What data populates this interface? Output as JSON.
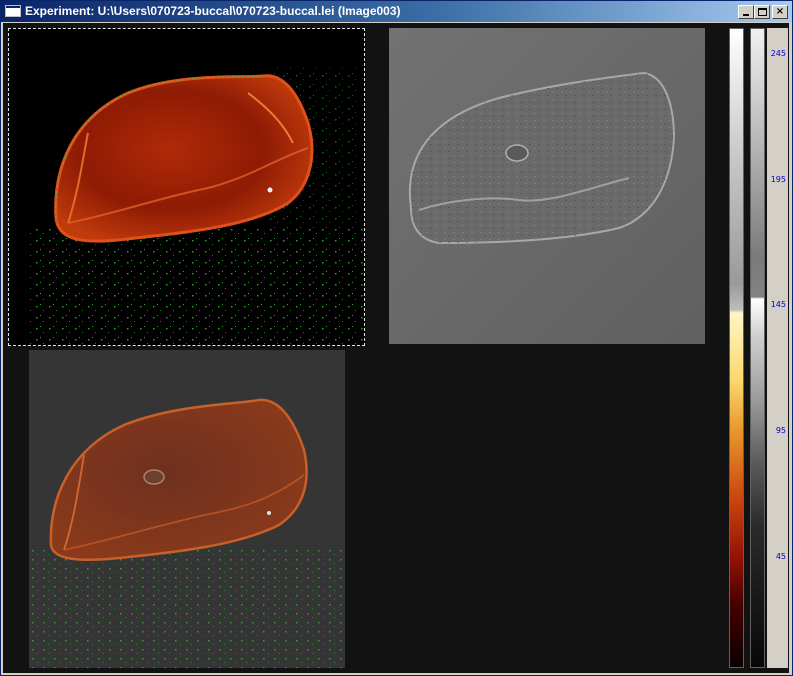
{
  "window": {
    "title": "Experiment: U:\\Users\\070723-buccal\\070723-buccal.lei  (Image003)",
    "minimize_label": "_",
    "maximize_label": "",
    "close_label": "×"
  },
  "panels": [
    {
      "name": "fluorescence-channel",
      "selected": true
    },
    {
      "name": "dic-channel",
      "selected": false
    },
    {
      "name": "overlay-channel",
      "selected": false
    }
  ],
  "scale": {
    "ticks": [
      "245",
      "195",
      "145",
      "95",
      "45"
    ]
  },
  "colors": {
    "title_gradient_start": "#0a246a",
    "title_gradient_end": "#a6caf0",
    "background": "#121212",
    "selection_border": "#e8e8e8",
    "tick_text": "#0000cc"
  }
}
